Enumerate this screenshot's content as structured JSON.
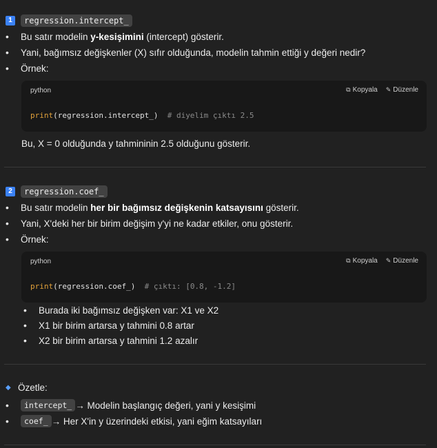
{
  "s1": {
    "num": "1",
    "title": "regression.intercept_",
    "b1_pre": "Bu satır modelin ",
    "b1_bold": "y-kesişimini",
    "b1_post": " (intercept) gösterir.",
    "b2": "Yani, bağımsız değişkenler (X) sıfır olduğunda, modelin tahmin ettiği y değeri nedir?",
    "b3": "Örnek:",
    "code": {
      "lang": "python",
      "copy": "Kopyala",
      "edit": "Düzenle",
      "fn": "print",
      "args": "(regression.intercept_)",
      "comment": "  # diyelim çıktı 2.5"
    },
    "after": "Bu, X = 0 olduğunda y tahmininin 2.5 olduğunu gösterir."
  },
  "s2": {
    "num": "2",
    "title": "regression.coef_",
    "b1_pre": "Bu satır modelin ",
    "b1_bold": "her bir bağımsız değişkenin katsayısını",
    "b1_post": " gösterir.",
    "b2": "Yani, X'deki her bir birim değişim y'yi ne kadar etkiler, onu gösterir.",
    "b3": "Örnek:",
    "code": {
      "lang": "python",
      "copy": "Kopyala",
      "edit": "Düzenle",
      "fn": "print",
      "args": "(regression.coef_)",
      "comment": "  # çıktı: [0.8, -1.2]"
    },
    "subs": [
      "Burada iki bağımsız değişken var: X1 ve X2",
      "X1 bir birim artarsa y tahmini 0.8 artar",
      "X2 bir birim artarsa y tahmini 1.2 azalır"
    ]
  },
  "summary": {
    "title": "Özetle:",
    "i1_code": "intercept_",
    "i1_text": " → Modelin başlangıç değeri, yani y kesişimi",
    "i2_code": "coef_",
    "i2_text": " → Her X'in y üzerindeki etkisi, yani eğim katsayıları"
  },
  "colors": {
    "accent": "#3b82f6",
    "code_fn": "#e0a03a",
    "code_comment": "#8a8a8a",
    "background": "#212121"
  },
  "icons": {
    "copy": "copy-icon",
    "edit": "pencil-icon",
    "summary": "diamond-icon"
  }
}
